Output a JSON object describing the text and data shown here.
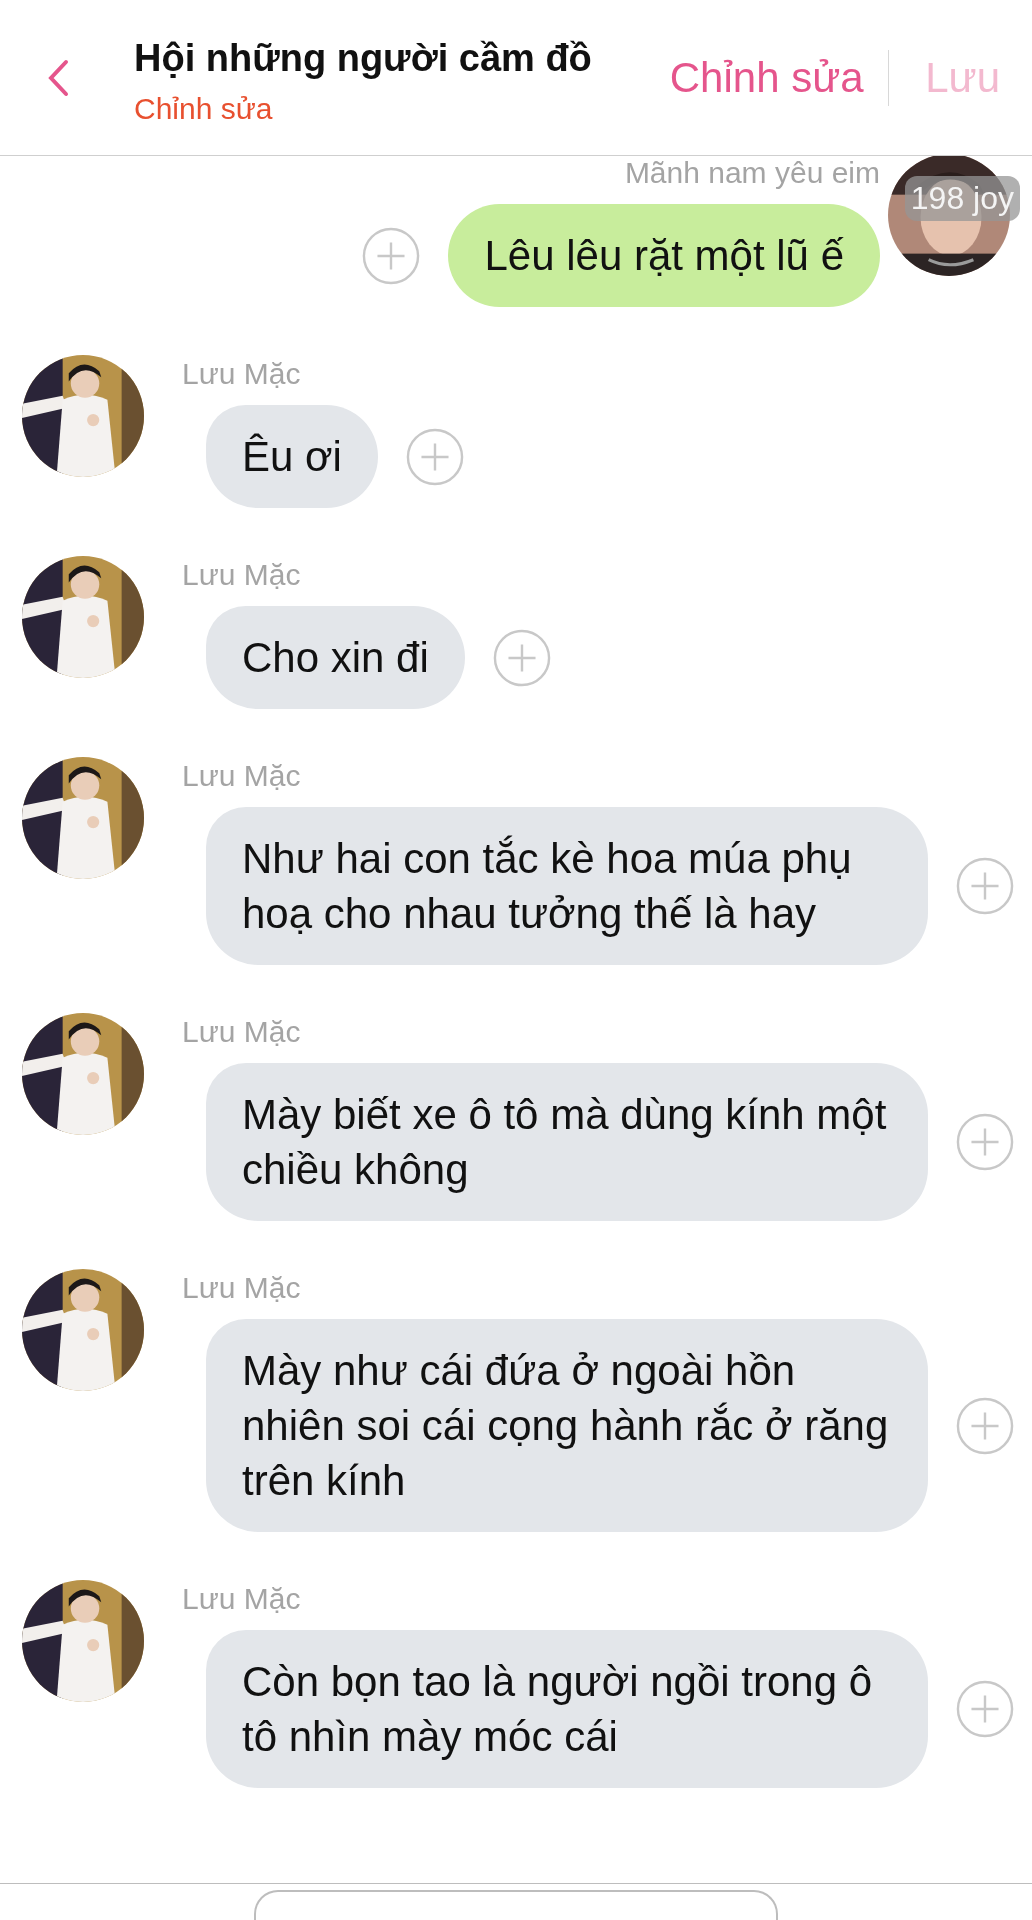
{
  "header": {
    "title": "Hội những người cầm đồ",
    "subtitle": "Chỉnh sửa",
    "edit_button": "Chỉnh sửa",
    "save_button": "Lưu",
    "save_disabled": true
  },
  "messages": [
    {
      "kind": "outgoing",
      "sender": "Mãnh nam yêu eim",
      "badge": "198 joy",
      "text": "Lêu lêu rặt một lũ ế"
    },
    {
      "kind": "incoming",
      "sender": "Lưu Mặc",
      "text": "Êu ơi"
    },
    {
      "kind": "incoming",
      "sender": "Lưu Mặc",
      "text": "Cho xin đi"
    },
    {
      "kind": "incoming",
      "sender": "Lưu Mặc",
      "text": "Như hai con tắc kè hoa múa phụ hoạ cho nhau tưởng thế là hay"
    },
    {
      "kind": "incoming",
      "sender": "Lưu Mặc",
      "text": "Mày biết xe ô tô mà dùng kính một chiều không"
    },
    {
      "kind": "incoming",
      "sender": "Lưu Mặc",
      "text": "Mày như cái đứa ở ngoài hồn nhiên soi cái cọng hành rắc ở răng trên kính"
    },
    {
      "kind": "incoming",
      "sender": "Lưu Mặc",
      "text": "Còn bọn tao là người ngồi trong ô tô nhìn mày móc cái"
    }
  ]
}
